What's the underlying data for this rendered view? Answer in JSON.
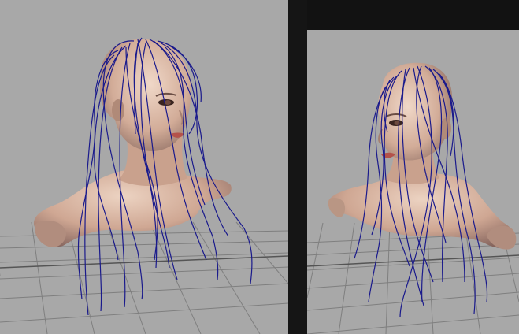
{
  "viewports": [
    {
      "view": "perspective",
      "subject": "bust-with-hair-guides"
    },
    {
      "view": "perspective",
      "subject": "bust-with-hair-guides"
    }
  ],
  "colors": {
    "viewport_bg": "#a8a8a8",
    "grid_line": "#7f7f7f",
    "grid_axis": "#555555",
    "skin_light": "#e2c4b2",
    "skin_mid": "#c9a18d",
    "skin_dark": "#7e5c52",
    "hair_curve": "#1a1a8c",
    "frame": "#151515"
  }
}
